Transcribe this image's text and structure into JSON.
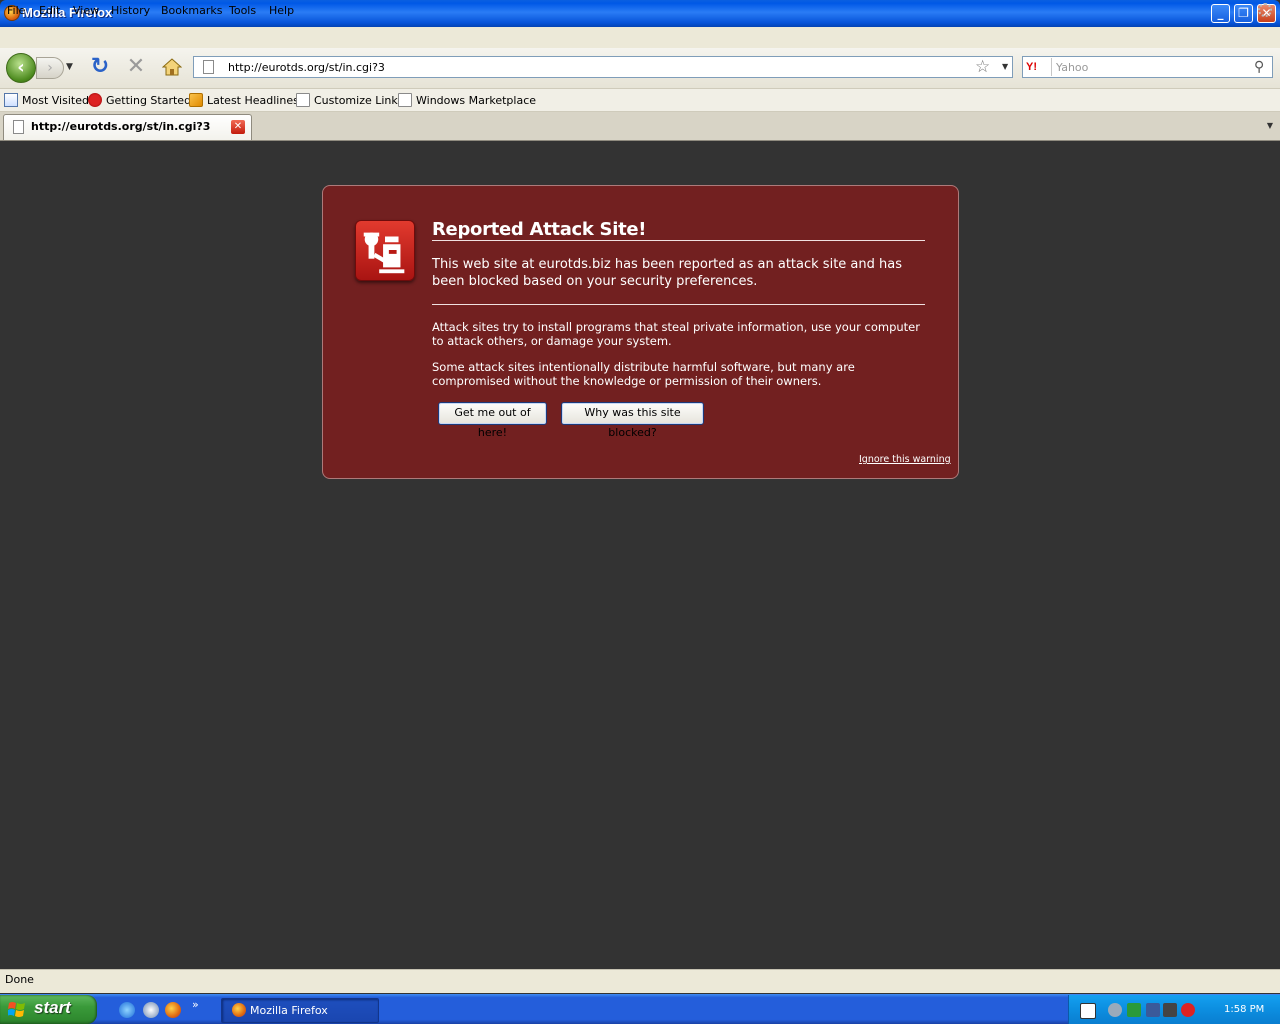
{
  "window": {
    "title": "Mozilla Firefox",
    "controls": {
      "minimize": "_",
      "maximize": "❐",
      "close": "✕"
    }
  },
  "menu": [
    "File",
    "Edit",
    "View",
    "History",
    "Bookmarks",
    "Tools",
    "Help"
  ],
  "nav": {
    "url": "http://eurotds.org/st/in.cgi?3",
    "search_engine": "Y!",
    "search_placeholder": "Yahoo"
  },
  "bookmarks": [
    {
      "label": "Most Visited",
      "icon": "most-visited-icon"
    },
    {
      "label": "Getting Started",
      "icon": "getting-started-icon"
    },
    {
      "label": "Latest Headlines",
      "icon": "rss-icon"
    },
    {
      "label": "Customize Links",
      "icon": "page-icon"
    },
    {
      "label": "Windows Marketplace",
      "icon": "page-icon"
    }
  ],
  "tab": {
    "title": "http://eurotds.org/st/in.cgi?3"
  },
  "error": {
    "title": "Reported Attack Site!",
    "short_desc": "This web site at eurotds.biz has been reported as an attack site and has been blocked based on your security preferences.",
    "long_desc_1": "Attack sites try to install programs that steal private information, use your computer to attack others, or damage your system.",
    "long_desc_2": "Some attack sites intentionally distribute harmful software, but many are compromised without the knowledge or permission of their owners.",
    "btn_getout": "Get me out of here!",
    "btn_why": "Why was this site blocked?",
    "ignore_link": "Ignore this warning",
    "colors": {
      "box": "#722020",
      "icon": "#c8201a"
    }
  },
  "status": {
    "text": "Done"
  },
  "taskbar": {
    "start_label": "start",
    "window_label": "Mozilla Firefox",
    "more": "»",
    "clock": "1:58 PM"
  }
}
